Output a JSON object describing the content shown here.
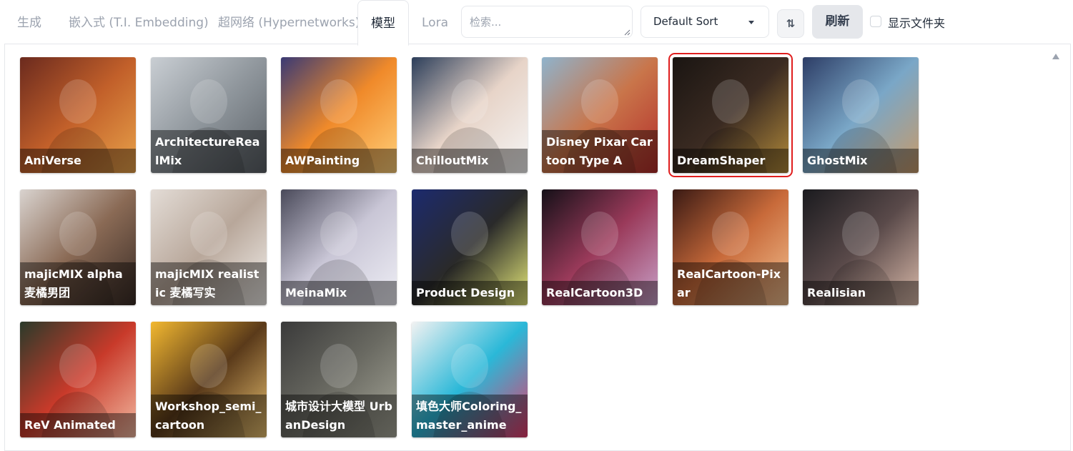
{
  "tabs": [
    "生成",
    "嵌入式 (T.I. Embedding)",
    "超网络 (Hypernetworks)",
    "模型",
    "Lora"
  ],
  "active_tab": "模型",
  "search": {
    "placeholder": "检索...",
    "value": ""
  },
  "sort": {
    "selected": "Default Sort",
    "direction_icon": "⇅"
  },
  "refresh_label": "刷新",
  "show_folders": {
    "label": "显示文件夹",
    "checked": false
  },
  "models": [
    {
      "name": "AniVerse",
      "icon": "anime-girl-armor-thumbnail",
      "colors": [
        "#6b2a1e",
        "#c2602a",
        "#e8a24a"
      ]
    },
    {
      "name": "ArchitectureRealMix",
      "icon": "skyscraper-thumbnail",
      "colors": [
        "#c9ced3",
        "#8f969c",
        "#5b6167"
      ]
    },
    {
      "name": "AWPainting",
      "icon": "anime-girl-colorful-thumbnail",
      "colors": [
        "#3a3a74",
        "#f08a2a",
        "#ffd07a"
      ]
    },
    {
      "name": "ChilloutMix",
      "icon": "woman-portrait-thumbnail",
      "colors": [
        "#2c3e5a",
        "#e7d4c8",
        "#f5f5f5"
      ]
    },
    {
      "name": "Disney Pixar Cartoon Type A",
      "icon": "cartoon-girl-hat-thumbnail",
      "colors": [
        "#8fb3cc",
        "#c9754a",
        "#b32d2a"
      ]
    },
    {
      "name": "DreamShaper",
      "icon": "dark-portrait-thumbnail",
      "colors": [
        "#1a1512",
        "#3b2b22",
        "#b28a3a"
      ]
    },
    {
      "name": "GhostMix",
      "icon": "fantasy-girl-thumbnail",
      "colors": [
        "#2d3d66",
        "#7aa7c7",
        "#c79a6a"
      ]
    },
    {
      "name": "majicMIX alpha 麦橘男团",
      "icon": "man-portrait-thumbnail",
      "colors": [
        "#d9d3cf",
        "#8a6a55",
        "#3a2c26"
      ]
    },
    {
      "name": "majicMIX realistic 麦橘写实",
      "icon": "woman-sweater-thumbnail",
      "colors": [
        "#e3dcd6",
        "#b8a79a",
        "#f2efeb"
      ]
    },
    {
      "name": "MeinaMix",
      "icon": "anime-white-hair-thumbnail",
      "colors": [
        "#4a4a5a",
        "#c9c6d6",
        "#eeeef5"
      ]
    },
    {
      "name": "Product Design",
      "icon": "product-shape-thumbnail",
      "colors": [
        "#1c2a6e",
        "#2a2a2a",
        "#e7ea7a"
      ]
    },
    {
      "name": "RealCartoon3D",
      "icon": "3d-cartoon-girl-thumbnail",
      "colors": [
        "#151018",
        "#9a3a5a",
        "#c8a0c8"
      ]
    },
    {
      "name": "RealCartoon-Pixar",
      "icon": "pixar-girl-thumbnail",
      "colors": [
        "#3a1a14",
        "#c86a3a",
        "#f2c090"
      ]
    },
    {
      "name": "Realisian",
      "icon": "woman-dark-portrait-thumbnail",
      "colors": [
        "#1b1b1f",
        "#5a4a4a",
        "#d8b8a8"
      ]
    },
    {
      "name": "ReV Animated",
      "icon": "torii-gate-thumbnail",
      "colors": [
        "#2a3a2a",
        "#c83a2a",
        "#f2b8a0"
      ]
    },
    {
      "name": "Workshop_semi_cartoon",
      "icon": "crowned-girl-thumbnail",
      "colors": [
        "#f2b830",
        "#5a3a1a",
        "#e8c070"
      ]
    },
    {
      "name": "城市设计大模型 UrbanDesign",
      "icon": "city-aerial-thumbnail",
      "colors": [
        "#3a3a3a",
        "#6a6a62",
        "#a8a89a"
      ]
    },
    {
      "name": "填色大师Coloring_master_anime",
      "icon": "colorful-anime-thumbnail",
      "colors": [
        "#f2f2f2",
        "#2ab8d8",
        "#e83a6a"
      ]
    }
  ],
  "selected_model": "DreamShaper"
}
